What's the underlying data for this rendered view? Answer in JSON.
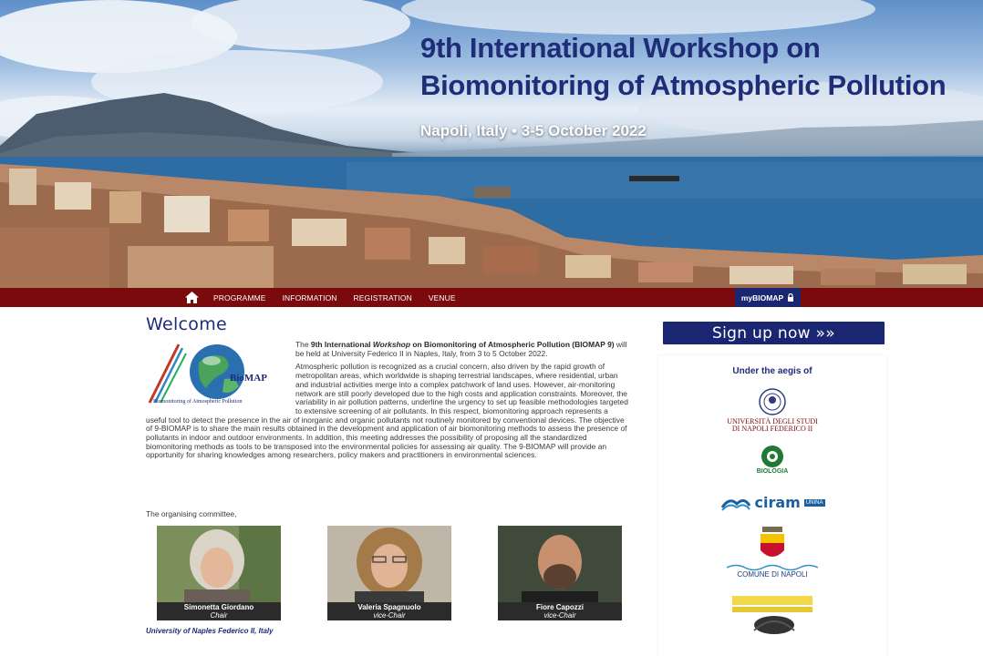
{
  "hero": {
    "title_line1": "9th International Workshop on",
    "title_line2": "Biomonitoring of Atmospheric Pollution",
    "subtitle": "Napoli, Italy • 3-5 October 2022"
  },
  "nav": {
    "items": [
      {
        "label": "PROGRAMME"
      },
      {
        "label": "INFORMATION"
      },
      {
        "label": "REGISTRATION"
      },
      {
        "label": "VENUE"
      }
    ],
    "mybiomap_label": "myBIOMAP"
  },
  "main": {
    "heading": "Welcome",
    "logo_text": "BioMAP",
    "logo_caption": "Biomonitoring of Atmospheric Pollution",
    "intro": {
      "pre": "The ",
      "bold1": "9th International ",
      "italic": "Workshop",
      "bold2": " on Biomonitoring of Atmospheric Pollution (BIOMAP 9)",
      "post": " will be held at University Federico II in Naples, Italy, from 3 to 5 October 2022."
    },
    "body": "Atmospheric pollution is recognized as a crucial concern, also driven by the rapid growth of metropolitan areas, which worldwide is shaping terrestrial landscapes, where residential, urban and industrial activities merge into a complex patchwork of land uses. However, air-monitoring network are still poorly developed due to the high costs and application constraints. Moreover, the variability in air pollution patterns, underline the urgency to set up feasible methodologies targeted to extensive screening of air pollutants. In this respect, biomonitoring approach represents a useful tool to detect the presence in the air of inorganic and organic pollutants not routinely monitored by conventional devices. The objective of 9-BIOMAP is to share the main results obtained in the development and application of air biomonitoring methods to assess the presence of pollutants in indoor and outdoor environments. In addition, this meeting addresses the possibility of proposing all the standardized biomonitoring methods as tools to be transposed into the environmental policies for assessing air quality. The 9-BIOMAP will provide an opportunity for sharing knowledges among researchers, policy makers and practitioners in environmental sciences.",
    "committee_label": "The organising committee,",
    "people": [
      {
        "name": "Simonetta Giordano",
        "role": "Chair"
      },
      {
        "name": "Valeria Spagnuolo",
        "role": "vice-Chair"
      },
      {
        "name": "Fiore Capozzi",
        "role": "vice-Chair"
      }
    ],
    "university": "University of Naples Federico II, Italy"
  },
  "sidebar": {
    "signup_label": "Sign up now »»",
    "aegis_title": "Under the aegis of",
    "sponsors": {
      "unina_line1": "UNIVERSITÀ DEGLI STUDI",
      "unina_line2": "DI NAPOLI FEDERICO II",
      "biologia": "BIOLOGIA",
      "ciram": "ciram",
      "ciram_tag": "UNINA",
      "comune": "COMUNE DI NAPOLI"
    }
  },
  "colors": {
    "brand_blue": "#1f2d78",
    "nav_red": "#7b0a0d",
    "button_blue": "#1b2672"
  }
}
